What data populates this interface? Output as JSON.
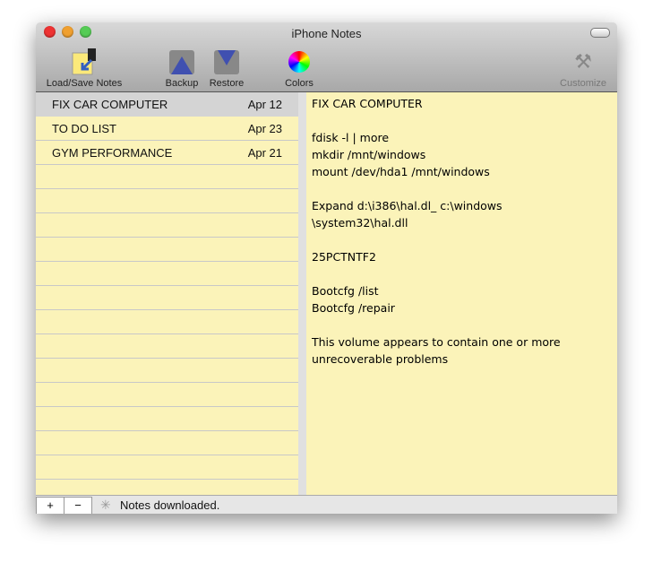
{
  "window": {
    "title": "iPhone Notes"
  },
  "toolbar": {
    "load_save": "Load/Save Notes",
    "backup": "Backup",
    "restore": "Restore",
    "colors": "Colors",
    "customize": "Customize"
  },
  "notes": [
    {
      "title": "FIX CAR COMPUTER",
      "date": "Apr 12",
      "selected": true
    },
    {
      "title": "TO DO LIST",
      "date": "Apr 23",
      "selected": false
    },
    {
      "title": "GYM PERFORMANCE",
      "date": "Apr 21",
      "selected": false
    }
  ],
  "editor": {
    "content": "FIX CAR COMPUTER\n\nfdisk -l | more\nmkdir /mnt/windows\nmount /dev/hda1 /mnt/windows\n\nExpand d:\\i386\\hal.dl_ c:\\windows\n\\system32\\hal.dll\n\n25PCTNTF2\n\nBootcfg /list\nBootcfg /repair\n\nThis volume appears to contain one or more\nunrecoverable problems"
  },
  "status": {
    "add": "+",
    "remove": "−",
    "text": "Notes downloaded."
  }
}
